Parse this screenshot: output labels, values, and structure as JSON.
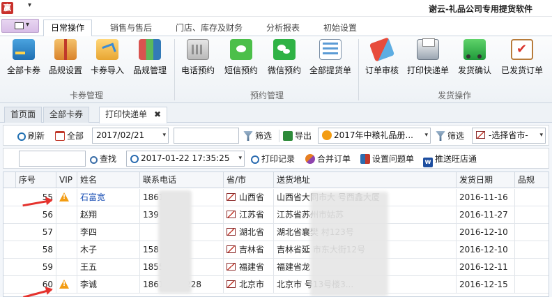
{
  "app": {
    "icon_text": "赢",
    "title": "谢云-礼品公司专用提货软件",
    "qat_caret": "▾"
  },
  "ribbon": {
    "tabs": [
      {
        "label": "日常操作",
        "active": true
      },
      {
        "label": "销售与售后",
        "active": false
      },
      {
        "label": "门店、库存及财务",
        "active": false
      },
      {
        "label": "分析报表",
        "active": false
      },
      {
        "label": "初始设置",
        "active": false
      }
    ],
    "groups": [
      {
        "label": "卡券管理",
        "buttons": [
          "全部卡券",
          "品规设置",
          "卡券导入",
          "品规管理"
        ]
      },
      {
        "label": "预约管理",
        "buttons": [
          "电话预约",
          "短信预约",
          "微信预约",
          "全部提货单"
        ]
      },
      {
        "label": "发货操作",
        "buttons": [
          "订单审核",
          "打印快递单",
          "发货确认",
          "已发货订单"
        ]
      }
    ]
  },
  "doc_tabs": [
    {
      "label": "首页面",
      "active": false
    },
    {
      "label": "全部卡券",
      "active": false
    },
    {
      "label": "打印快递单",
      "active": true,
      "close": "✖"
    }
  ],
  "toolbar1": {
    "refresh": "刷新",
    "all": "全部",
    "date_value": "2017/02/21",
    "search_value": "",
    "filter1": "筛选",
    "export": "导出",
    "product_value": "2017年中粮礼品册...",
    "filter2": "筛选",
    "province_value": "-选择省市-"
  },
  "toolbar2": {
    "input_value": "",
    "find": "查找",
    "datetime_value": "2017-01-22 17:35:25",
    "print_log": "打印记录",
    "merge": "合并订单",
    "set_issue": "设置问题单",
    "push_wangdian": "推送旺店通",
    "push_icon_text": "w"
  },
  "table": {
    "columns": [
      "序号",
      "VIP",
      "姓名",
      "联系电话",
      "省/市",
      "送货地址",
      "发货日期",
      "品规"
    ],
    "rows": [
      {
        "no": "55",
        "vip": true,
        "name": "石富宽",
        "phone": "1861   228",
        "province": "山西省",
        "address": "山西省大同市大    号西鑫大厦",
        "date": "2016-11-16",
        "highlight": true
      },
      {
        "no": "56",
        "vip": false,
        "name": "赵翔",
        "phone": "139    94",
        "province": "江苏省",
        "address": "江苏省苏州市姑苏",
        "date": "2016-11-27"
      },
      {
        "no": "57",
        "vip": false,
        "name": "李四",
        "phone": "",
        "province": "湖北省",
        "address": "湖北省襄樊    村123号",
        "date": "2016-12-10"
      },
      {
        "no": "58",
        "vip": false,
        "name": "木子",
        "phone": "158    225",
        "province": "吉林省",
        "address": "吉林省延    市东大街12号",
        "date": "2016-12-10"
      },
      {
        "no": "59",
        "vip": false,
        "name": "王五",
        "phone": "1855    93",
        "province": "福建省",
        "address": "福建省龙",
        "date": "2016-12-11"
      },
      {
        "no": "60",
        "vip": true,
        "name": "李诚",
        "phone": "18611168228",
        "province": "北京市",
        "address": "北京市    号13号楼3...",
        "date": "2016-12-15"
      }
    ]
  },
  "icons": {
    "vip_warning": "!",
    "dropdown": "▾"
  }
}
